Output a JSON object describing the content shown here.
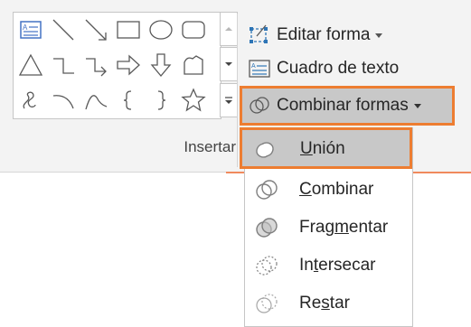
{
  "ribbon": {
    "group_label": "Insertar",
    "edit_shape": {
      "label": "Editar forma",
      "icon": "edit-shape-icon"
    },
    "text_box": {
      "label": "Cuadro de texto",
      "icon": "text-box-icon"
    },
    "merge_shapes": {
      "label": "Combinar formas",
      "icon": "merge-shapes-icon"
    }
  },
  "gallery": {
    "shapes": [
      "text-box",
      "line",
      "arrow-line",
      "rectangle",
      "oval",
      "rounded-rectangle",
      "triangle",
      "elbow-connector",
      "elbow-arrow-connector",
      "right-arrow",
      "down-arrow",
      "freeform",
      "scribble",
      "arc",
      "curve",
      "left-brace",
      "right-brace",
      "star"
    ]
  },
  "menu": {
    "items": [
      {
        "label_pre": "",
        "label_key": "U",
        "label_post": "nión",
        "icon": "union-icon"
      },
      {
        "label_pre": "",
        "label_key": "C",
        "label_post": "ombinar",
        "icon": "combine-icon"
      },
      {
        "label_pre": "Frag",
        "label_key": "m",
        "label_post": "entar",
        "icon": "fragment-icon"
      },
      {
        "label_pre": "In",
        "label_key": "t",
        "label_post": "ersecar",
        "icon": "intersect-icon"
      },
      {
        "label_pre": "Re",
        "label_key": "s",
        "label_post": "tar",
        "icon": "subtract-icon"
      }
    ]
  },
  "colors": {
    "highlight_border": "#ed7d31",
    "highlight_fill": "#c8c8c8",
    "accent_line": "#f08a5d"
  }
}
